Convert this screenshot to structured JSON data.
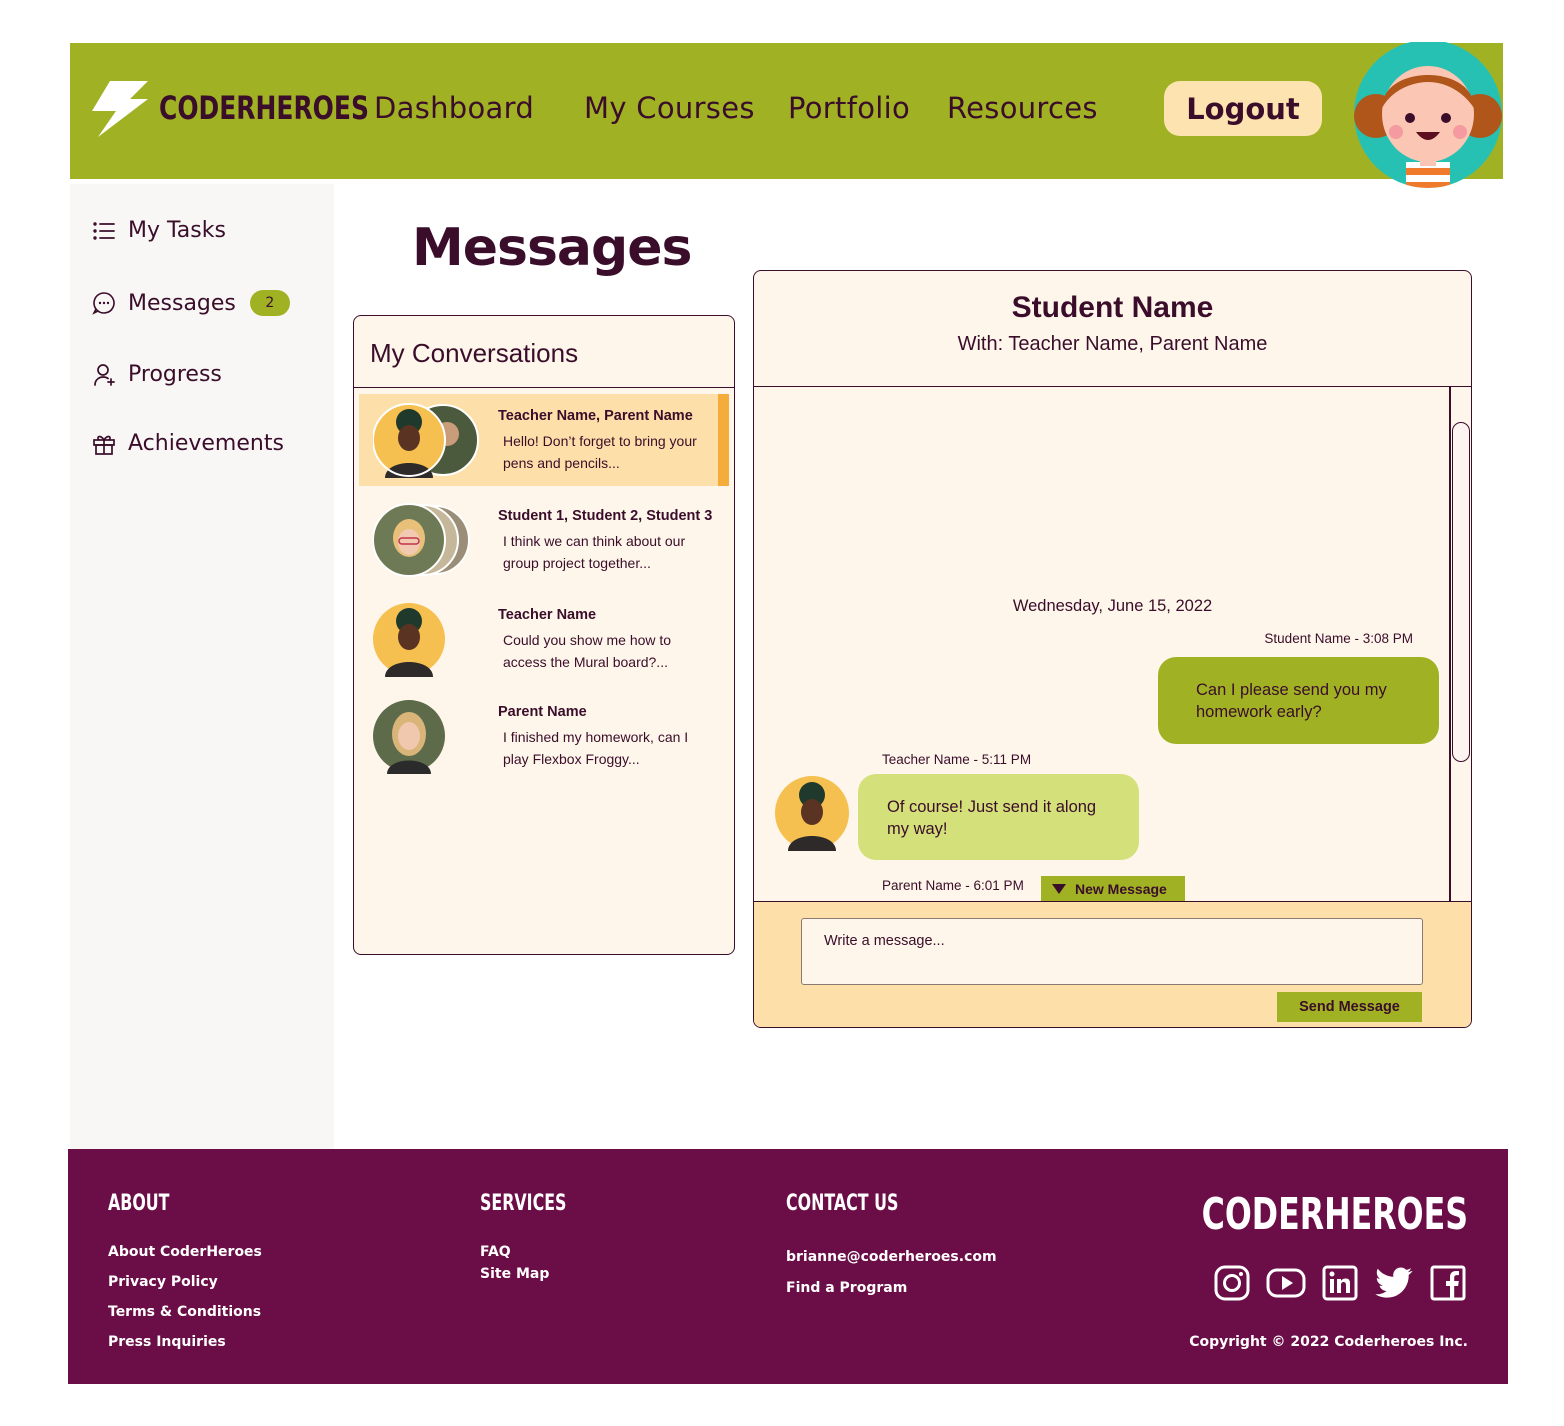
{
  "brand": {
    "name": "CODERHEROES"
  },
  "nav": {
    "items": [
      {
        "label": "Dashboard"
      },
      {
        "label": "My Courses"
      },
      {
        "label": "Portfolio"
      },
      {
        "label": "Resources"
      }
    ],
    "logout_label": "Logout"
  },
  "sidebar": {
    "items": [
      {
        "label": "My Tasks",
        "icon": "list-icon"
      },
      {
        "label": "Messages",
        "icon": "chat-icon",
        "badge": "2"
      },
      {
        "label": "Progress",
        "icon": "user-plus-icon"
      },
      {
        "label": "Achievements",
        "icon": "gift-icon"
      }
    ]
  },
  "page": {
    "title": "Messages"
  },
  "conversations": {
    "heading": "My Conversations",
    "items": [
      {
        "name": "Teacher Name, Parent Name",
        "preview": "Hello! Don’t forget to bring your pens and pencils...",
        "active": true
      },
      {
        "name": "Student 1, Student 2, Student 3",
        "preview": "I think we can think about our group project together...",
        "active": false
      },
      {
        "name": "Teacher Name",
        "preview": "Could you show me how to access the Mural board?...",
        "active": false
      },
      {
        "name": "Parent Name",
        "preview": "I finished my homework, can I play Flexbox Froggy...",
        "active": false
      }
    ]
  },
  "chat": {
    "title": "Student Name",
    "participants": "With: Teacher Name, Parent Name",
    "date": "Wednesday, June 15, 2022",
    "messages": [
      {
        "meta": "Student Name - 3:08 PM",
        "text": "Can I please send you my homework early?",
        "direction": "outgoing"
      },
      {
        "meta": "Teacher Name - 5:11 PM",
        "text": "Of course! Just send it along my way!",
        "direction": "incoming"
      },
      {
        "meta": "Parent Name - 6:01 PM"
      }
    ],
    "new_message_label": "New Message",
    "input_placeholder": "Write a message...",
    "send_label": "Send Message"
  },
  "footer": {
    "about": {
      "heading": "ABOUT",
      "links": [
        "About CoderHeroes",
        "Privacy Policy",
        "Terms & Conditions",
        "Press Inquiries"
      ]
    },
    "services": {
      "heading": "SERVICES",
      "links": [
        "FAQ",
        "Site Map"
      ]
    },
    "contact": {
      "heading": "CONTACT US",
      "links": [
        "brianne@coderheroes.com",
        "Find a Program"
      ]
    },
    "brand": "CODERHEROES",
    "social": [
      "instagram-icon",
      "youtube-icon",
      "linkedin-icon",
      "twitter-icon",
      "facebook-icon"
    ],
    "copyright": "Copyright © 2022 Coderheroes Inc."
  },
  "colors": {
    "header_green": "#a0b224",
    "plum": "#3a0d2a",
    "footer_plum": "#6b0d46",
    "cream": "#fef6ea",
    "peach": "#fde0a9",
    "orange_accent": "#f6ac3a",
    "light_green_bubble": "#d4e07a"
  }
}
